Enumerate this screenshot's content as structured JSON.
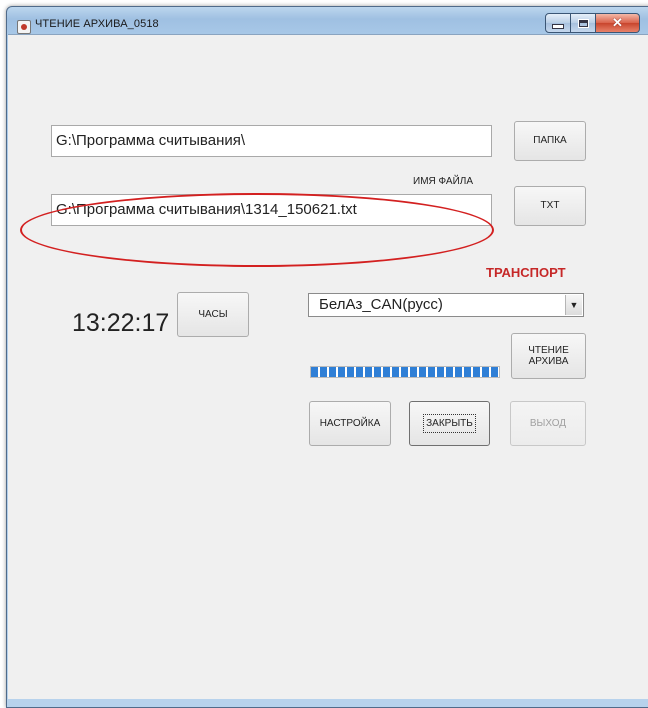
{
  "window": {
    "title": "ЧТЕНИЕ АРХИВА_0518",
    "title_icon": "app-icon"
  },
  "folder": {
    "path": "G:\\Программа считывания\\",
    "button_label": "ПАПКА"
  },
  "file": {
    "caption": "ИМЯ ФАЙЛА",
    "path": "G:\\Программа считывания\\1314_150621.txt",
    "button_label": "TXT"
  },
  "transport": {
    "caption": "ТРАНСПОРТ",
    "selected": "БелАз_CAN(русс)"
  },
  "clock": {
    "time": "13:22:17",
    "button_label": "ЧАСЫ"
  },
  "read_archive": {
    "label_line1": "ЧТЕНИЕ",
    "label_line2": "АРХИВА"
  },
  "progress": {
    "fraction": 1.0
  },
  "buttons": {
    "settings": "НАСТРОЙКА",
    "close": "ЗАКРЫТЬ",
    "exit": "ВЫХОД"
  },
  "colors": {
    "accent_red": "#c62828",
    "progress_blue": "#2f7fd6",
    "annotation_red": "#d32020"
  }
}
